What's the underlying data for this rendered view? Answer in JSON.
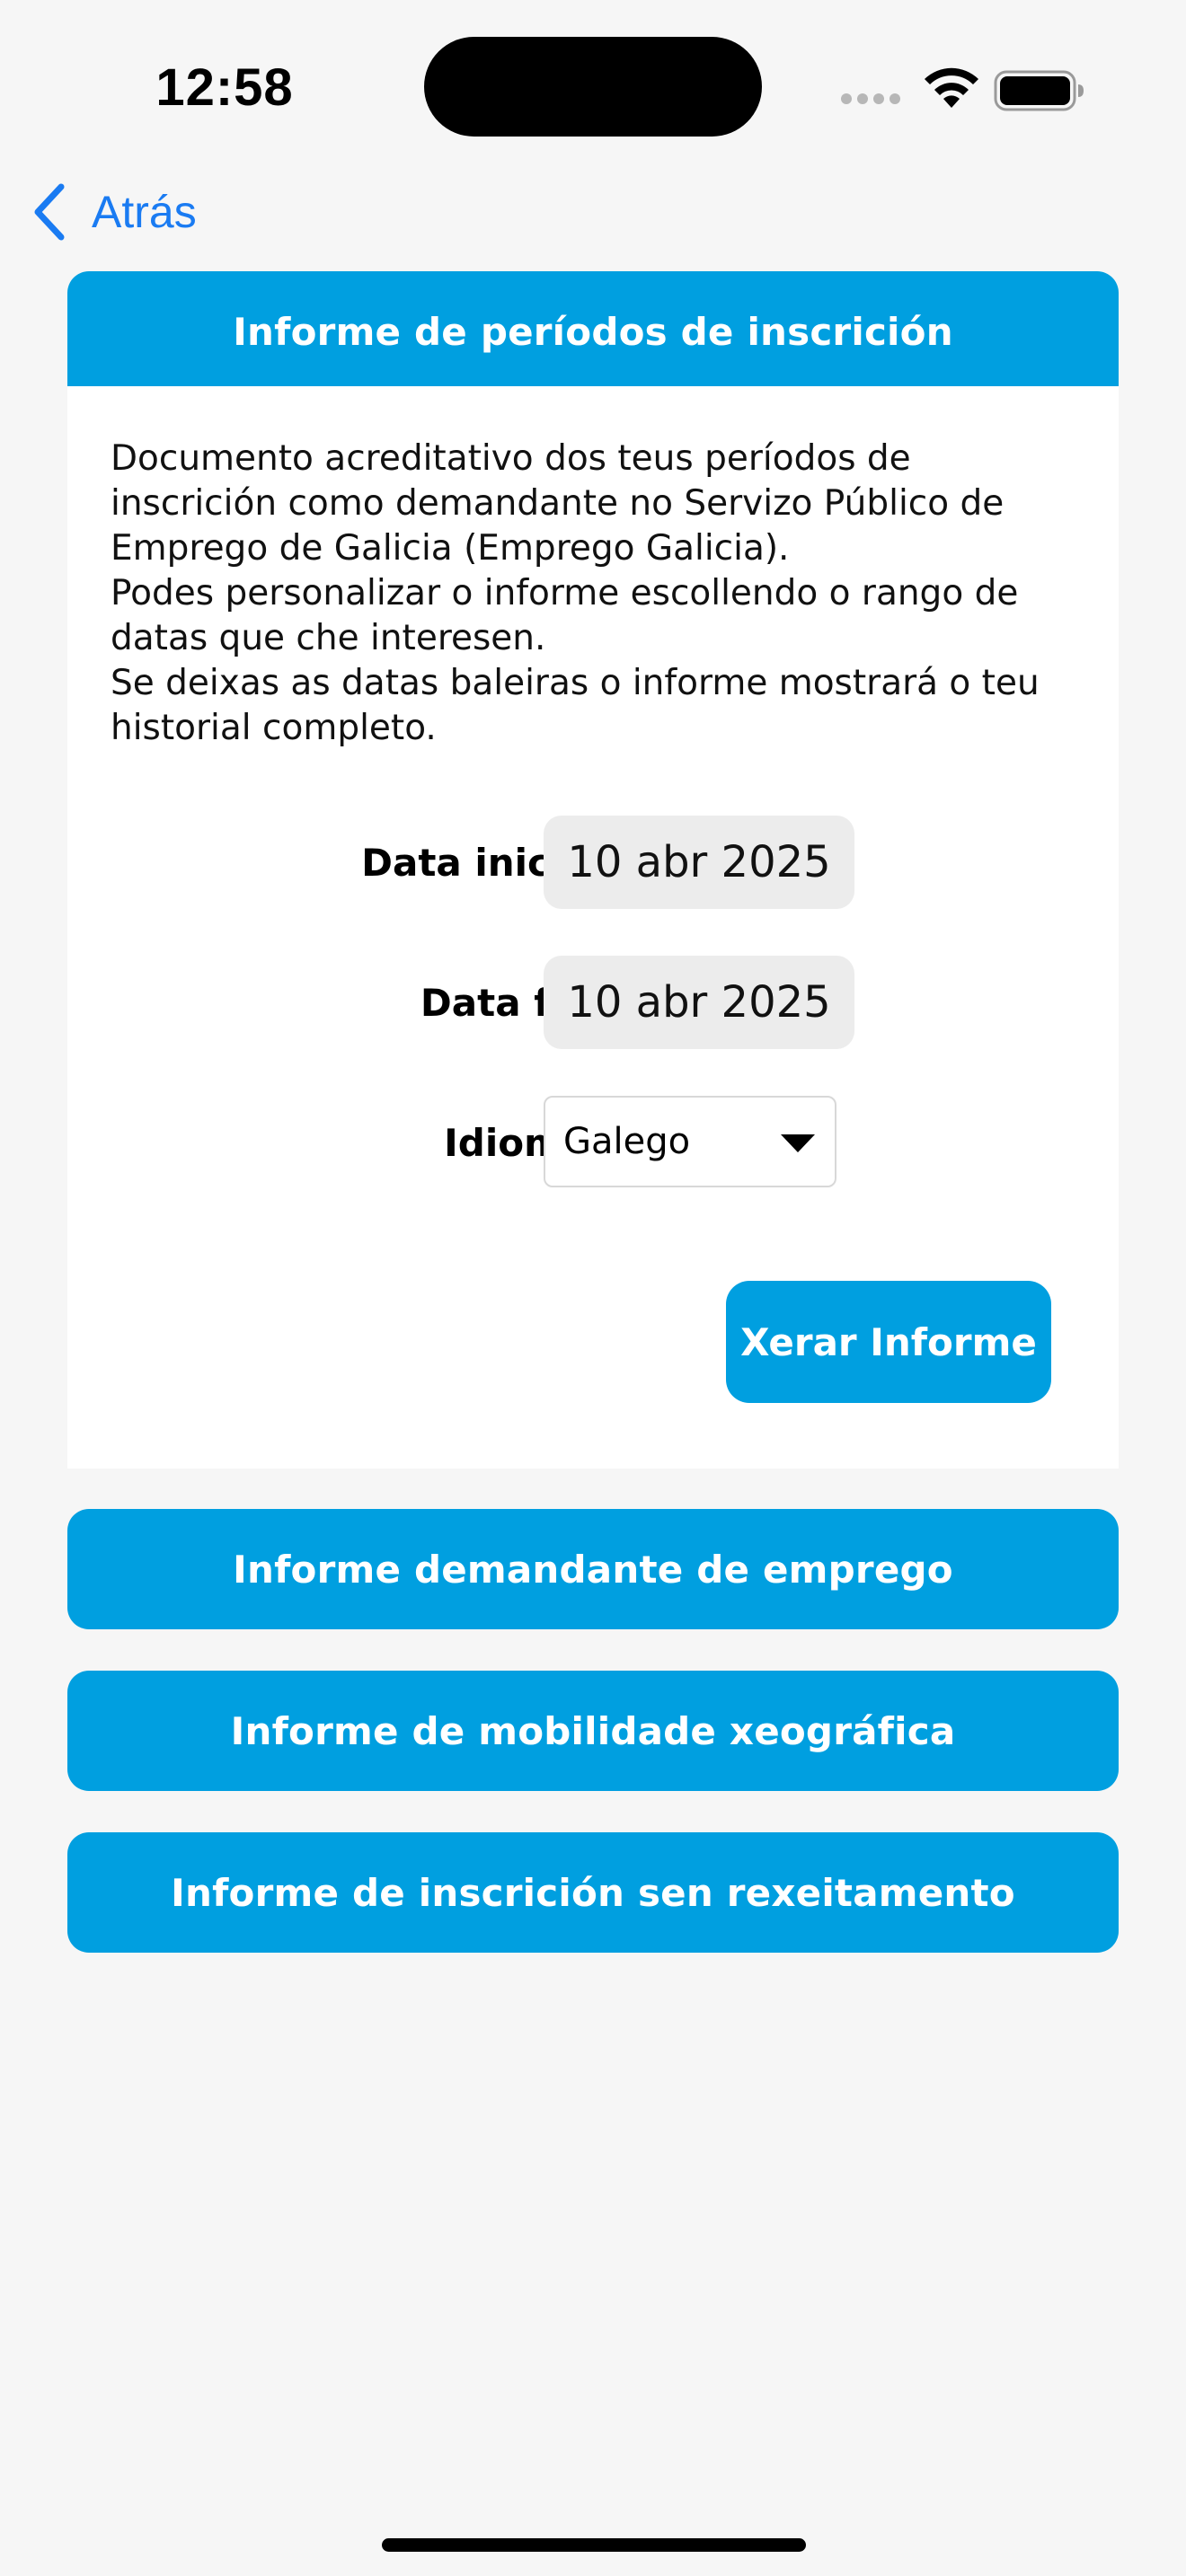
{
  "status_bar": {
    "time": "12:58"
  },
  "nav": {
    "back_label": "Atrás"
  },
  "section": {
    "title": "Informe de períodos de inscrición",
    "description_lines": [
      "Documento acreditativo dos teus períodos de inscrición como demandante no Servizo Público de Emprego de Galicia (Emprego Galicia).",
      "Podes personalizar o informe escollendo o rango de datas que che interesen.",
      "Se deixas as datas baleiras o informe mostrará o teu historial completo."
    ],
    "start_date_label": "Data inicio:",
    "start_date_value": "10 abr 2025",
    "end_date_label": "Data fin:",
    "end_date_value": "10 abr 2025",
    "language_label": "Idioma:",
    "language_value": "Galego",
    "generate_button": "Xerar Informe"
  },
  "reports": [
    {
      "label": "Informe demandante de emprego"
    },
    {
      "label": "Informe de mobilidade xeográfica"
    },
    {
      "label": "Informe de inscrición sen rexeitamento"
    }
  ],
  "colors": {
    "accent": "#009fe0",
    "link": "#1a7bf2",
    "background": "#f6f6f6",
    "date_pill": "#ececec"
  }
}
